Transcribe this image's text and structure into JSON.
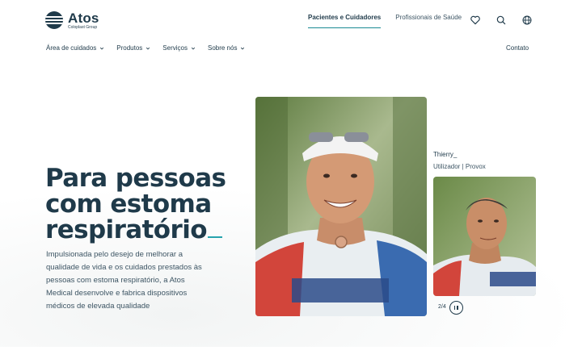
{
  "brand": {
    "name": "Atos",
    "subtitle": "Coloplast Group"
  },
  "header": {
    "tabs": [
      {
        "label": "Pacientes e Cuidadores",
        "active": true
      },
      {
        "label": "Profissionais de Saúde",
        "active": false
      }
    ],
    "icons": [
      "heart-icon",
      "search-icon",
      "globe-icon"
    ]
  },
  "nav": {
    "items": [
      {
        "label": "Área de cuidados"
      },
      {
        "label": "Produtos"
      },
      {
        "label": "Serviços"
      },
      {
        "label": "Sobre nós"
      }
    ],
    "contact": "Contato"
  },
  "hero": {
    "title_line1": "Para pessoas",
    "title_line2": "com estoma",
    "title_line3": "respiratório",
    "description": "Impulsionada pelo desejo de melhorar a qualidade de vida e os cuidados prestados às pessoas com estoma respiratório, a Atos Medical desenvolve e fabrica dispositivos médicos de elevada qualidade"
  },
  "carousel": {
    "person_name": "Thierry_",
    "person_role": "Utilizador | Provox",
    "counter": "2/4"
  },
  "colors": {
    "primary": "#1f3a4a",
    "accent": "#26a3ad",
    "text_muted": "#3d5564"
  }
}
